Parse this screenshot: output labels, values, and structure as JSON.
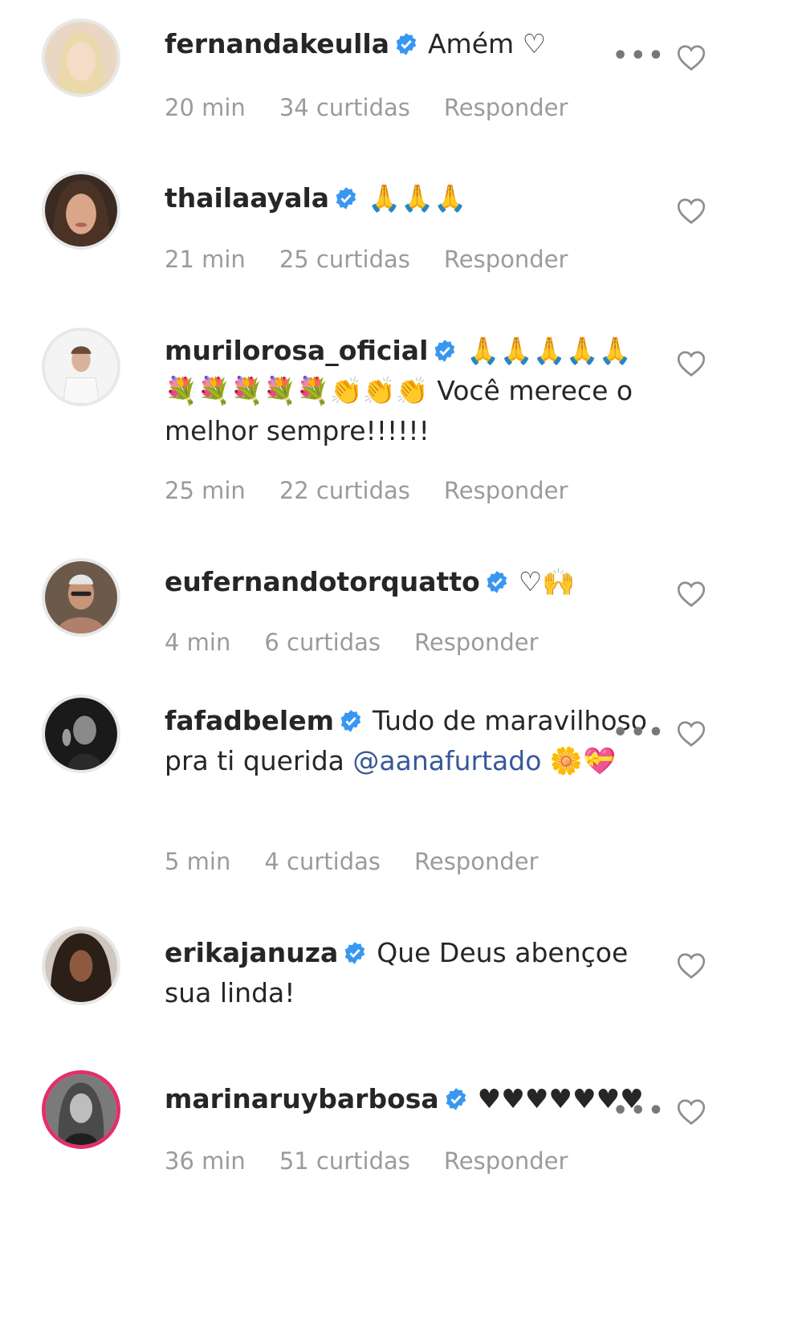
{
  "comments": [
    {
      "username": "fernandakeulla",
      "text": "Amém ♡",
      "time": "20 min",
      "likes": "34 curtidas",
      "reply": "Responder"
    },
    {
      "username": "thailaayala",
      "text": "🙏🙏🙏",
      "time": "21 min",
      "likes": "25 curtidas",
      "reply": "Responder"
    },
    {
      "username": "murilorosa_oficial",
      "text": "🙏🙏🙏🙏🙏💐💐💐💐💐👏👏👏 Você merece o melhor sempre!!!!!!",
      "time": "25 min",
      "likes": "22 curtidas",
      "reply": "Responder"
    },
    {
      "username": "eufernandotorquatto",
      "text": "♡🙌",
      "time": "4 min",
      "likes": "6 curtidas",
      "reply": "Responder"
    },
    {
      "username": "fafadbelem",
      "text": "Tudo de maravilhoso pra ti querida",
      "mention": "@aanafurtado",
      "text_after": " 🌼💝",
      "time": "5 min",
      "likes": "4 curtidas",
      "reply": "Responder"
    },
    {
      "username": "erikajanuza",
      "text": "Que Deus abençoe sua linda!"
    },
    {
      "username": "marinaruybarbosa",
      "text": "♥♥♥♥♥♥♥",
      "time": "36 min",
      "likes": "51 curtidas",
      "reply": "Responder"
    }
  ],
  "icons": {
    "verified": "verified-badge-icon",
    "like": "heart-outline-icon",
    "more": "more-options-icon"
  },
  "colors": {
    "verified": "#3897f0",
    "meta": "#9b9b9b",
    "mention": "#385898",
    "story_ring": "#e1306c"
  }
}
